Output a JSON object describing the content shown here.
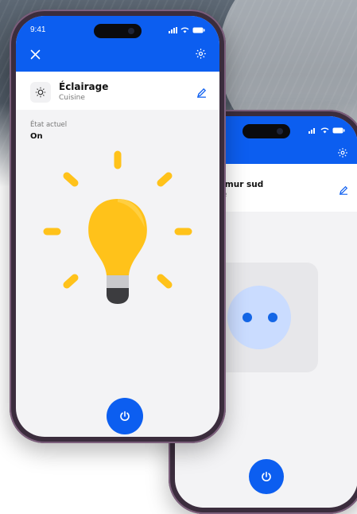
{
  "front_phone": {
    "status_time": "9:41",
    "device": {
      "name": "Éclairage",
      "room": "Cuisine",
      "icon": "lightbulb-icon"
    },
    "state": {
      "label": "État actuel",
      "value": "On"
    },
    "power": {
      "icon": "power-icon"
    }
  },
  "back_phone": {
    "device": {
      "name_partial": "e mur sud",
      "room_partial": "me"
    },
    "power": {
      "icon": "power-icon"
    }
  },
  "colors": {
    "accent": "#0c5ef0",
    "bulb_yellow": "#ffc21a",
    "socket_face": "#cadcff"
  }
}
